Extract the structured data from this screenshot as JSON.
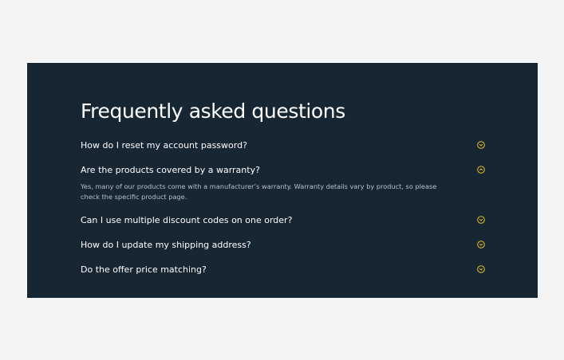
{
  "faq": {
    "title": "Frequently asked questions",
    "accent_color": "#e8c12a",
    "background_color": "#172633",
    "items": [
      {
        "question": "How do I reset my account password?",
        "expanded": false,
        "icon": "chevron-down-icon"
      },
      {
        "question": "Are the products covered by a warranty?",
        "expanded": true,
        "icon": "chevron-up-icon",
        "answer": "Yes, many of our products come with a manufacturer’s warranty. Warranty details vary by product, so please check the specific product page."
      },
      {
        "question": "Can I use multiple discount codes on one order?",
        "expanded": false,
        "icon": "chevron-down-icon"
      },
      {
        "question": "How do I update my shipping address?",
        "expanded": false,
        "icon": "chevron-down-icon"
      },
      {
        "question": "Do the offer price matching?",
        "expanded": false,
        "icon": "chevron-down-icon"
      }
    ]
  }
}
